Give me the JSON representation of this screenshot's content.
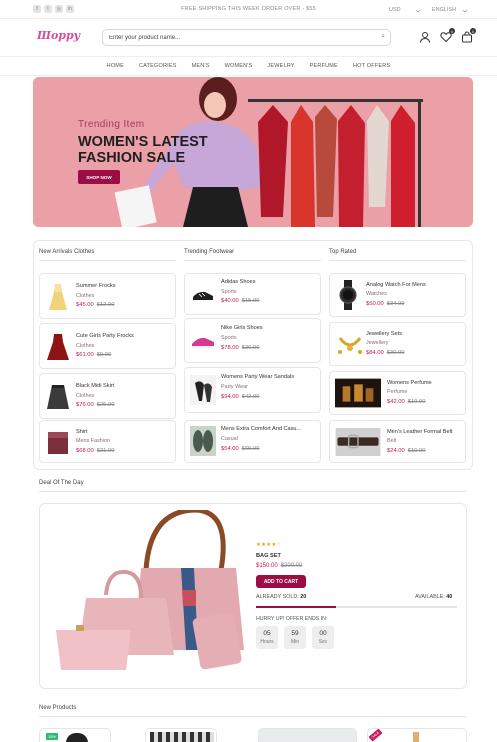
{
  "topbar": {
    "social_icons": [
      "facebook-icon",
      "twitter-icon",
      "instagram-icon",
      "linkedin-icon"
    ],
    "shipping_text": "FREE SHIPPING THIS WEEK ORDER OVER - $55",
    "currency": "USD",
    "language": "ENGLISH"
  },
  "header": {
    "logo": "Шорру",
    "search_placeholder": "Enter your product name...",
    "wishlist_count": "0",
    "cart_count": "0"
  },
  "nav": {
    "items": [
      "HOME",
      "CATEGORIES",
      "MEN'S",
      "WOMEN'S",
      "JEWELRY",
      "PERFUME",
      "HOT OFFERS"
    ]
  },
  "hero": {
    "subtitle": "Trending Item",
    "title": "WOMEN'S LATEST FASHION SALE",
    "button": "SHOP NOW"
  },
  "columns": [
    {
      "title": "New Arrivals Clothes",
      "items": [
        {
          "name": "Summer Frocks",
          "category": "Clothes",
          "price": "$45.00",
          "old_price": "$12.00"
        },
        {
          "name": "Cute Girls Party Frocks",
          "category": "Clothes",
          "price": "$61.00",
          "old_price": "$9.00"
        },
        {
          "name": "Black Midi Skirt",
          "category": "Clothes",
          "price": "$76.00",
          "old_price": "$25.00"
        },
        {
          "name": "Shirt",
          "category": "Mens Fashion",
          "price": "$68.00",
          "old_price": "$31.00"
        }
      ]
    },
    {
      "title": "Trending Footwear",
      "items": [
        {
          "name": "Adidas Shoes",
          "category": "Sports",
          "price": "$40.00",
          "old_price": "$15.00"
        },
        {
          "name": "Nike Girls Shoes",
          "category": "Sports",
          "price": "$78.00",
          "old_price": "$36.00"
        },
        {
          "name": "Womens Party Wear Sandals",
          "category": "Party Wear",
          "price": "$94.00",
          "old_price": "$42.00"
        },
        {
          "name": "Mens Extra Comfort And Casu...",
          "category": "Casual",
          "price": "$54.00",
          "old_price": "$65.00"
        }
      ]
    },
    {
      "title": "Top Rated",
      "items": [
        {
          "name": "Analog Watch For Mens",
          "category": "Watches",
          "price": "$50.00",
          "old_price": "$34.00"
        },
        {
          "name": "Jewellery Sets",
          "category": "Jewellery",
          "price": "$84.00",
          "old_price": "$30.00"
        },
        {
          "name": "Womens Perfume",
          "category": "Perfume",
          "price": "$42.00",
          "old_price": "$10.00"
        },
        {
          "name": "Men's Leather Formal Belt",
          "category": "Belt",
          "price": "$24.00",
          "old_price": "$10.00"
        }
      ]
    }
  ],
  "deal": {
    "section_title": "Deal Of The Day",
    "rating": 4,
    "rating_max": 5,
    "name": "BAG SET",
    "price": "$150.00",
    "old_price": "$200.00",
    "button": "ADD TO CART",
    "sold_label": "ALREADY SOLD:",
    "sold": "20",
    "available_label": "AVAILABLE:",
    "available": "40",
    "sold_fraction": 0.4,
    "hurry_text": "HURRY UP! OFFER ENDS IN:",
    "timer": [
      {
        "value": "05",
        "label": "Hours"
      },
      {
        "value": "59",
        "label": "Min"
      },
      {
        "value": "00",
        "label": "Sec"
      }
    ]
  },
  "new_products": {
    "section_title": "New Products",
    "badges": [
      "15%",
      "SALE"
    ]
  },
  "colors": {
    "accent": "#9a0e45",
    "price": "#c2185b",
    "hero_bg": "#eb9fa6"
  }
}
